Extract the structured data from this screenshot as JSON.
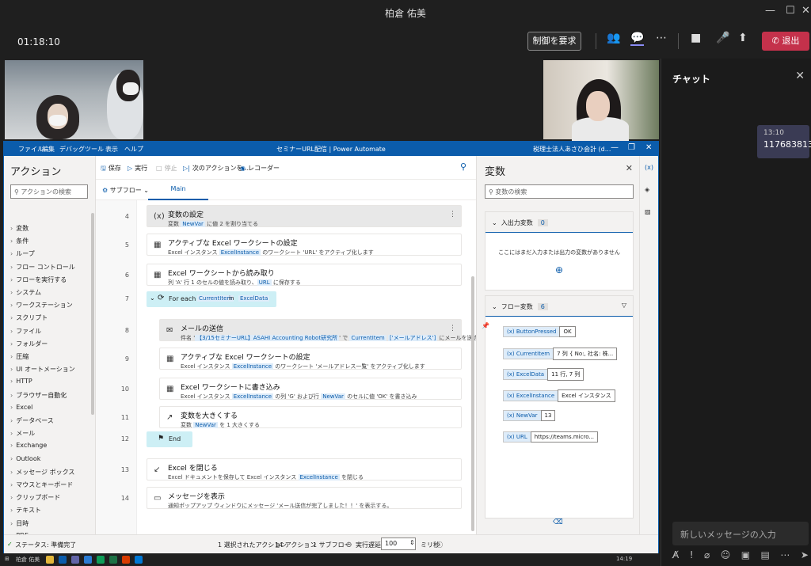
{
  "window": {
    "title": "柏倉 佑美"
  },
  "meeting": {
    "timer": "01:18:10",
    "request_control": "制御を要求",
    "leave": "退出"
  },
  "chat": {
    "title": "チャット",
    "message_time": "13:10",
    "message_text": "1176838135",
    "input_placeholder": "新しいメッセージの入力"
  },
  "pad": {
    "menu": [
      "ファイル",
      "編集",
      "デバッグ",
      "ツール",
      "表示",
      "ヘルプ"
    ],
    "window_title": "セミナーURL配信 | Power Automate",
    "account": "税理士法人あさひ会計 (d...",
    "actions_title": "アクション",
    "actions_search": "アクションの検索",
    "action_groups": [
      "変数",
      "条件",
      "ループ",
      "フロー コントロール",
      "フローを実行する",
      "システム",
      "ワークステーション",
      "スクリプト",
      "ファイル",
      "フォルダー",
      "圧縮",
      "UI オートメーション",
      "HTTP",
      "ブラウザー自動化",
      "Excel",
      "データベース",
      "メール",
      "Exchange",
      "Outlook",
      "メッセージ ボックス",
      "マウスとキーボード",
      "クリップボード",
      "テキスト",
      "日時",
      "PDF"
    ],
    "toolbar": {
      "save": "保存",
      "run": "実行",
      "stop": "停止",
      "next": "次のアクションを...",
      "recorder": "レコーダー"
    },
    "subflow": "サブフロー",
    "main_tab": "Main",
    "steps": [
      {
        "num": "4",
        "title": "変数の設定",
        "desc_a": "変数 ",
        "tok1": "NewVar",
        "desc_b": " に値 2 を割り当てる",
        "tok2": "",
        "desc_c": "",
        "tok3": "",
        "desc_d": ""
      },
      {
        "num": "5",
        "title": "アクティブな Excel ワークシートの設定",
        "desc_a": "Excel インスタンス ",
        "tok1": "ExcelInstance",
        "desc_b": " のワークシート 'URL' をアクティブ化します",
        "tok2": "",
        "desc_c": "",
        "tok3": "",
        "desc_d": ""
      },
      {
        "num": "6",
        "title": "Excel ワークシートから読み取り",
        "desc_a": "列 'A' 行 1 のセルの値を読み取り、",
        "tok1": "URL",
        "desc_b": " に保存する",
        "tok2": "",
        "desc_c": "",
        "tok3": "",
        "desc_d": ""
      },
      {
        "num": "8",
        "title": "メールの送信",
        "desc_a": "件名 '",
        "tok1": "【3/15セミナーURL】ASAHI Accounting Robot研究所",
        "desc_b": "' で ",
        "tok2": "CurrentItem",
        "desc_c": " ",
        "tok3": "['メールアドレス']",
        "desc_d": " にメールを送信します"
      },
      {
        "num": "9",
        "title": "アクティブな Excel ワークシートの設定",
        "desc_a": "Excel インスタンス ",
        "tok1": "ExcelInstance",
        "desc_b": " のワークシート 'メールアドレス一覧' をアクティブ化します",
        "tok2": "",
        "desc_c": "",
        "tok3": "",
        "desc_d": ""
      },
      {
        "num": "10",
        "title": "Excel ワークシートに書き込み",
        "desc_a": "Excel インスタンス ",
        "tok1": "ExcelInstance",
        "desc_b": " の列 'G' および行 ",
        "tok2": "NewVar",
        "desc_c": " のセルに値 'OK' を書き込み",
        "tok3": "",
        "desc_d": ""
      },
      {
        "num": "11",
        "title": "変数を大きくする",
        "desc_a": "変数 ",
        "tok1": "NewVar",
        "desc_b": " を 1 大きくする",
        "tok2": "",
        "desc_c": "",
        "tok3": "",
        "desc_d": ""
      },
      {
        "num": "13",
        "title": "Excel を閉じる",
        "desc_a": "Excel ドキュメントを保存して Excel インスタンス ",
        "tok1": "ExcelInstance",
        "desc_b": " を閉じる",
        "tok2": "",
        "desc_c": "",
        "tok3": "",
        "desc_d": ""
      },
      {
        "num": "14",
        "title": "メッセージを表示",
        "desc_a": "通知ポップアップ ウィンドウにメッセージ 'メール送信が完了しました！！' を表示する。",
        "tok1": "",
        "desc_b": "",
        "tok2": "",
        "desc_c": "",
        "tok3": "",
        "desc_d": ""
      }
    ],
    "foreach": {
      "num": "7",
      "label": "For each",
      "item": "CurrentItem",
      "in": "in",
      "source": "ExcelData"
    },
    "end": {
      "num": "12",
      "label": "End"
    },
    "vars_title": "変数",
    "vars_search": "変数の検索",
    "io_section": {
      "title": "入出力変数",
      "count": "0",
      "empty": "ここにはまだ入力または出力の変数がありません"
    },
    "flow_section": {
      "title": "フロー変数",
      "count": "6"
    },
    "flow_vars": [
      {
        "name": "ButtonPressed",
        "value": "OK"
      },
      {
        "name": "CurrentItem",
        "value": "7 列 { No:, 社名: 株..."
      },
      {
        "name": "ExcelData",
        "value": "11 行, 7 列"
      },
      {
        "name": "ExcelInstance",
        "value": "Excel インスタンス"
      },
      {
        "name": "NewVar",
        "value": "13"
      },
      {
        "name": "URL",
        "value": "https://teams.micro..."
      }
    ],
    "status": {
      "state": "ステータス: 準備完了",
      "selected": "1 選択されたアクション",
      "actions": "14 アクション",
      "subflows": "1 サブフロー",
      "delay_label": "実行遅延",
      "delay_value": "100",
      "unit": "ミリ秒"
    }
  },
  "taskbar": {
    "user": "柏倉 佑美",
    "time": "14:19"
  },
  "colors": {
    "accent": "#0b5cab",
    "leave": "#c4314b",
    "foreach_bg": "#cdeff5"
  }
}
